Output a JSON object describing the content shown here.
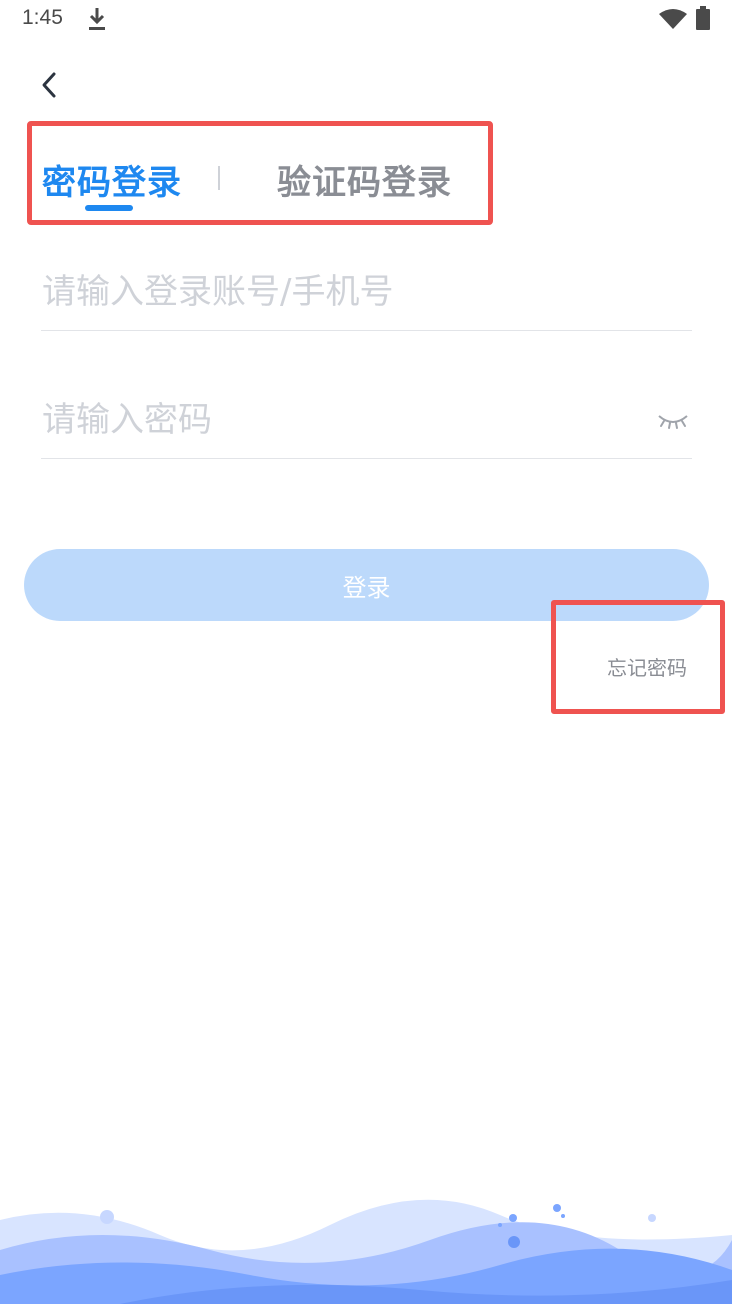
{
  "status_bar": {
    "time": "1:45"
  },
  "tabs": {
    "active_label": "密码登录",
    "inactive_label": "验证码登录"
  },
  "form": {
    "account_placeholder": "请输入登录账号/手机号",
    "password_placeholder": "请输入密码",
    "login_label": "登录",
    "forgot_label": "忘记密码"
  },
  "colors": {
    "accent": "#1e88f0",
    "login_button": "#bcd9fb",
    "highlight_box": "#ef5350",
    "wave": "#7ba5ff"
  },
  "icons": [
    "download-icon",
    "wifi-icon",
    "battery-icon",
    "back-arrow-icon",
    "eye-closed-icon"
  ]
}
